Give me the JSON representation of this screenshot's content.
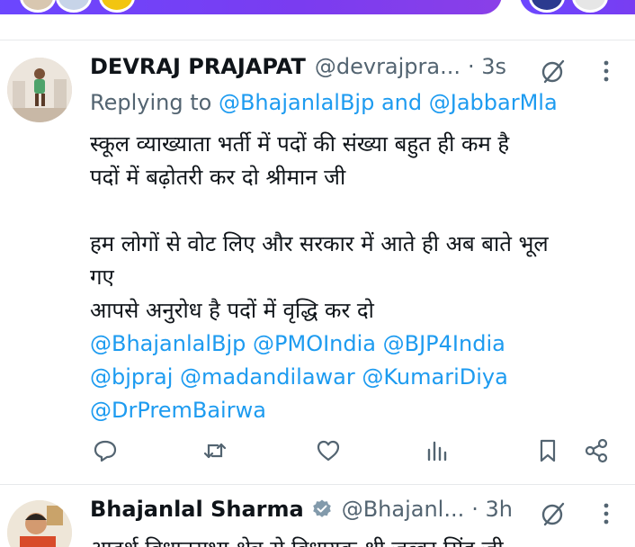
{
  "tweet1": {
    "name": "DEVRAJ PRAJAPAT",
    "handle": "@devrajpra...",
    "time": "· 3s",
    "replying_prefix": "Replying to ",
    "replying_user1": "@BhajanlalBjp",
    "replying_and": " and ",
    "replying_user2": "@JabbarMla",
    "text_line1": "स्कूल व्याख्याता भर्ती में पदों की संख्या बहुत ही कम है",
    "text_line2": "पदों में बढ़ोतरी कर दो श्रीमान जी",
    "text_line3": "हम लोगों से वोट लिए और सरकार में आते ही अब बाते भूल",
    "text_line4": "गए",
    "text_line5": "आपसे अनुरोध है पदों में वृद्धि कर दो",
    "mention1": "@BhajanlalBjp",
    "mention2": "@PMOIndia",
    "mention3": "@BJP4India",
    "mention4": "@bjpraj",
    "mention5": "@madandilawar",
    "mention6": "@KumariDiya",
    "mention7": "@DrPremBairwa"
  },
  "tweet2": {
    "name": "Bhajanlal Sharma",
    "handle": "@Bhajanl...",
    "time": "· 3h",
    "text_partial": "आदर्श विधानसभा क्षेत्र से विधायक श्री जब्बर सिंह जी"
  },
  "colors": {
    "link": "#1d9bf0",
    "secondary_text": "#536471",
    "verified": "#829aab",
    "banner": "#6b47ff"
  },
  "icons": [
    "reply-icon",
    "retweet-icon",
    "like-icon",
    "views-icon",
    "bookmark-icon",
    "share-icon",
    "grok-icon",
    "more-icon",
    "verified-badge-icon"
  ]
}
